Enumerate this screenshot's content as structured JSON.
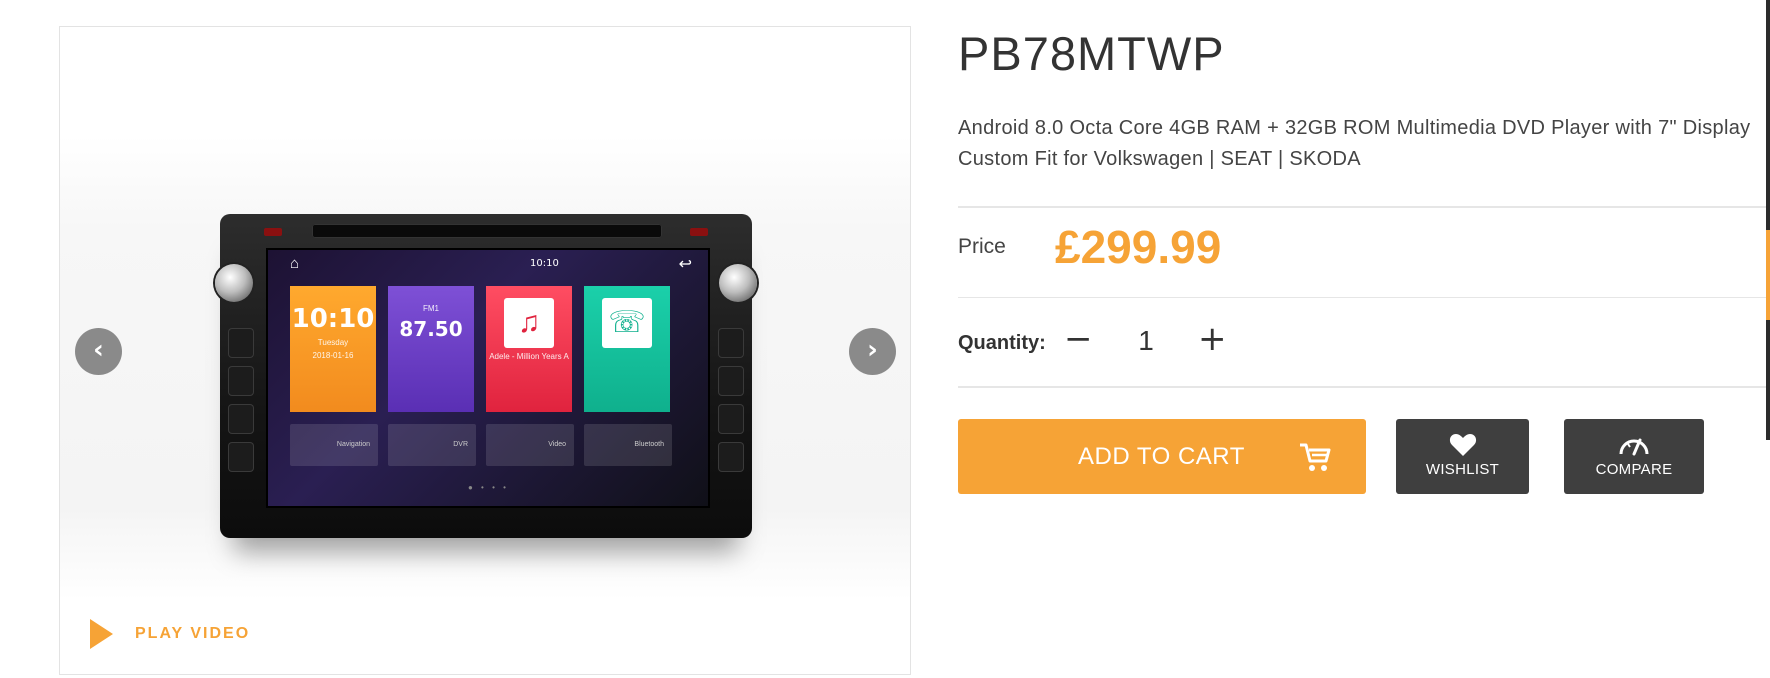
{
  "product": {
    "sku": "PB78MTWP",
    "description": "Android 8.0 Octa Core 4GB RAM + 32GB ROM Multimedia DVD Player with 7\" Display Custom Fit for Volkswagen | SEAT | SKODA",
    "price_label": "Price",
    "price": "£299.99"
  },
  "gallery": {
    "prev_icon": "chevron-left-icon",
    "next_icon": "chevron-right-icon",
    "play_video_label": "PLAY VIDEO",
    "screen": {
      "clock": "10:10",
      "tile_time": "10:10",
      "tile_day": "Tuesday",
      "tile_date": "2018-01-16",
      "tile_radio_band": "FM1",
      "tile_radio_freq": "87.50",
      "tile_music_track": "Adele - Million Years A",
      "shortcuts": [
        "Navigation",
        "DVR",
        "Video",
        "Bluetooth"
      ]
    }
  },
  "quantity": {
    "label": "Quantity:",
    "value": "1",
    "minus": "−",
    "plus": "+"
  },
  "actions": {
    "add_to_cart": "ADD TO CART",
    "wishlist": "WISHLIST",
    "compare": "COMPARE"
  },
  "colors": {
    "accent": "#f6a336",
    "dark_button": "#3f3f3f",
    "text": "#333333"
  }
}
